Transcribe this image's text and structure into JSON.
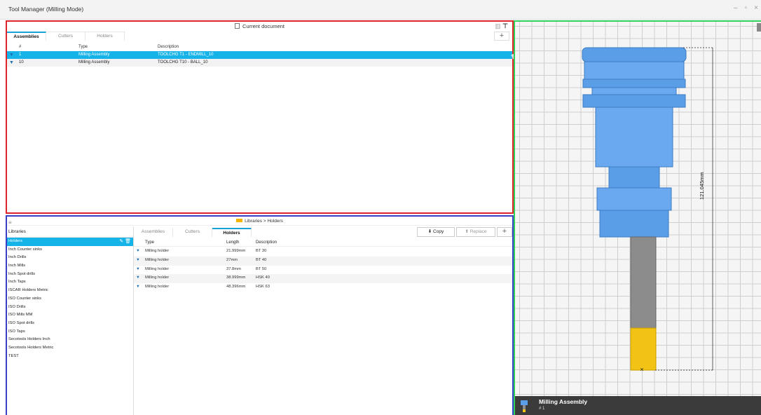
{
  "window": {
    "title": "Tool Manager (Milling Mode)",
    "controls": [
      "–",
      "▫",
      "×"
    ]
  },
  "top_panel": {
    "header": "Current document",
    "tabs": [
      "Assemblies",
      "Cutters",
      "Holders"
    ],
    "active_tab": "Assemblies",
    "columns": [
      "#",
      "Type",
      "Description"
    ],
    "rows": [
      {
        "num": "1",
        "type": "Milling Assembly",
        "description": "TOOLCHG T1 - ENDMILL_10",
        "selected": true
      },
      {
        "num": "10",
        "type": "Milling Assembly",
        "description": "TOOLCHG T10 - BALL_10",
        "selected": false
      }
    ]
  },
  "bottom_panel": {
    "breadcrumb": "Libraries > Holders",
    "libraries_title": "Libraries",
    "libraries": [
      "Holders",
      "Inch Counter sinks",
      "Inch Drills",
      "Inch Mills",
      "Inch Spot drills",
      "Inch Taps",
      "ISCAR Holders Metric",
      "ISO Counter sinks",
      "ISO Drills",
      "ISO Mills MM",
      "ISO Spot drills",
      "ISO Taps",
      "Secotools Holders Inch",
      "Secotools Holders Metric",
      "TEST"
    ],
    "selected_library": "Holders",
    "tabs": [
      "Assemblies",
      "Cutters",
      "Holders"
    ],
    "active_tab": "Holders",
    "copy_label": "Copy",
    "replace_label": "Replace",
    "columns": [
      "Type",
      "Length",
      "Description"
    ],
    "rows": [
      {
        "type": "Milling holder",
        "length": "21.999mm",
        "description": "BT 30"
      },
      {
        "type": "Milling holder",
        "length": "27mm",
        "description": "BT 40"
      },
      {
        "type": "Milling holder",
        "length": "37.8mm",
        "description": "BT 50"
      },
      {
        "type": "Milling holder",
        "length": "38.999mm",
        "description": "HSK 40"
      },
      {
        "type": "Milling holder",
        "length": "48.396mm",
        "description": "HSK 63"
      }
    ]
  },
  "viewer": {
    "dimension": "121.045mm",
    "footer_name": "Milling Assembly",
    "footer_number": "# 1",
    "colors": {
      "holder": "#5b9ee8",
      "shank": "#8c8c8c",
      "cutter": "#f2c315"
    }
  }
}
